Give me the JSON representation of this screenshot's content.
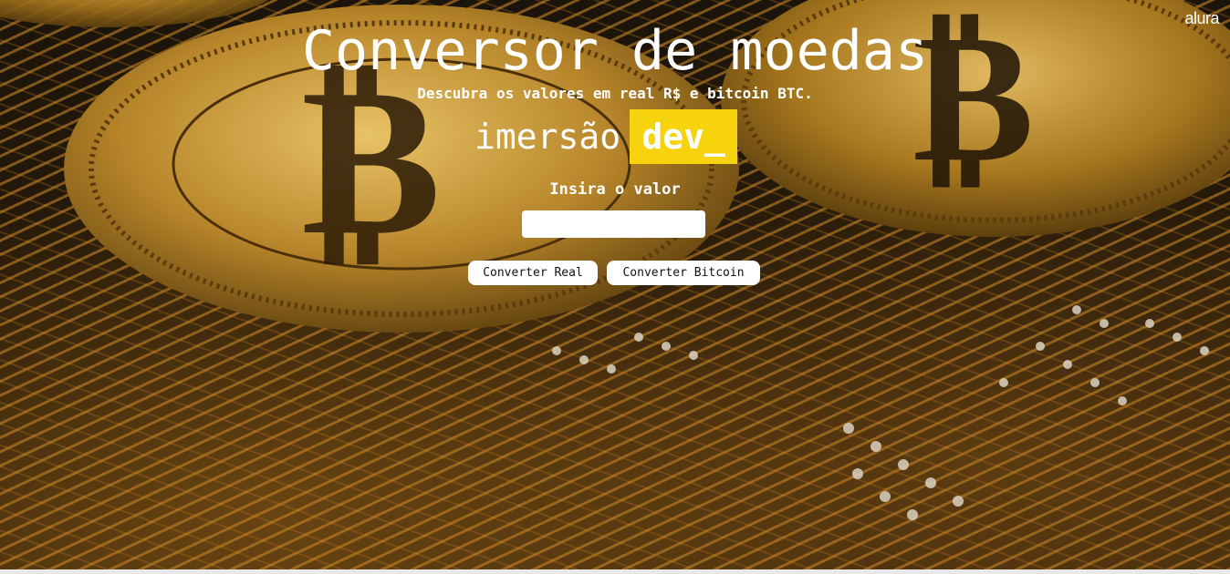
{
  "header": {
    "logo": "alura",
    "title": "Conversor de moedas",
    "subtitle": "Descubra os valores em real R$ e bitcoin BTC."
  },
  "brand": {
    "word": "imersão",
    "highlight": "dev_",
    "highlight_color": "#f6d30c"
  },
  "form": {
    "label": "Insira o valor",
    "input_value": "",
    "buttons": {
      "real": "Converter Real",
      "bitcoin": "Converter Bitcoin"
    }
  },
  "background": {
    "description_icon": "bitcoin-circuit-background"
  }
}
